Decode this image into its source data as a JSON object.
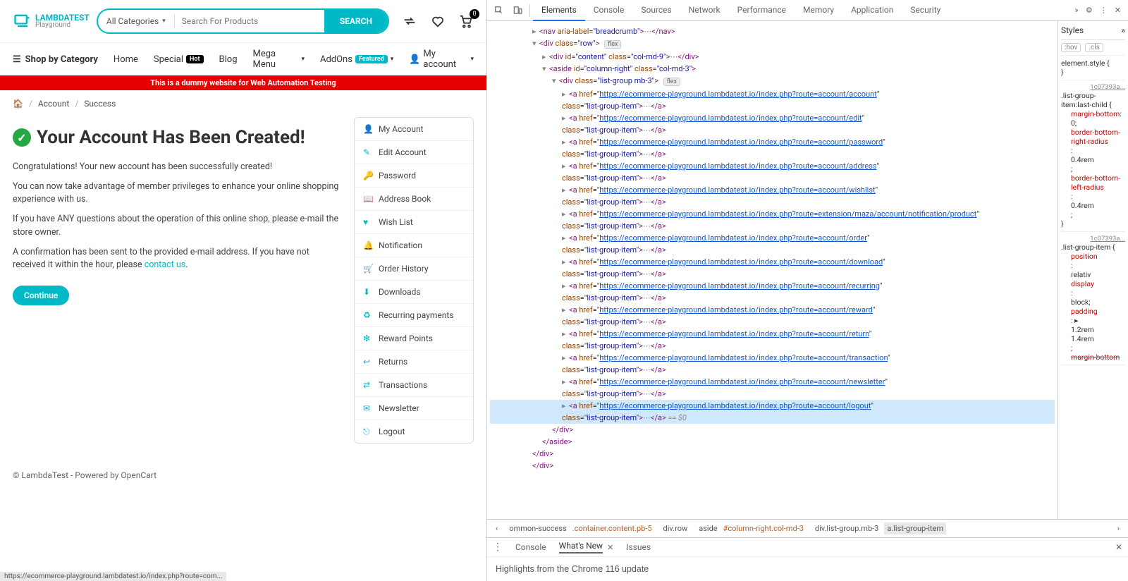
{
  "logo": {
    "line1": "LAMBDATEST",
    "line2": "Playground"
  },
  "search": {
    "category": "All Categories",
    "placeholder": "Search For Products",
    "button": "SEARCH"
  },
  "cart_badge": "0",
  "nav": {
    "shop_cat": "Shop by Category",
    "items": [
      {
        "label": "Home"
      },
      {
        "label": "Special",
        "pill": "Hot"
      },
      {
        "label": "Blog"
      },
      {
        "label": "Mega Menu",
        "caret": true
      },
      {
        "label": "AddOns",
        "pill": "Featured",
        "pillClass": "teal",
        "caret": true
      },
      {
        "label": "My account",
        "caret": true,
        "user": true
      }
    ]
  },
  "redbar": "This is a dummy website for Web Automation Testing",
  "crumbs": [
    "Account",
    "Success"
  ],
  "h1": "Your Account Has Been Created!",
  "paras": [
    "Congratulations! Your new account has been successfully created!",
    "You can now take advantage of member privileges to enhance your online shopping experience with us.",
    "If you have ANY questions about the operation of this online shop, please e-mail the store owner.",
    "A confirmation has been sent to the provided e-mail address. If you have not received it within the hour, please "
  ],
  "contact": "contact us",
  "continue": "Continue",
  "sidebar": [
    {
      "icon": "user",
      "label": "My Account"
    },
    {
      "icon": "edit",
      "label": "Edit Account"
    },
    {
      "icon": "key",
      "label": "Password"
    },
    {
      "icon": "book",
      "label": "Address Book"
    },
    {
      "icon": "heart",
      "label": "Wish List"
    },
    {
      "icon": "bell",
      "label": "Notification"
    },
    {
      "icon": "cart",
      "label": "Order History"
    },
    {
      "icon": "download",
      "label": "Downloads"
    },
    {
      "icon": "refresh",
      "label": "Recurring payments"
    },
    {
      "icon": "gift",
      "label": "Reward Points"
    },
    {
      "icon": "return",
      "label": "Returns"
    },
    {
      "icon": "transaction",
      "label": "Transactions"
    },
    {
      "icon": "mail",
      "label": "Newsletter"
    },
    {
      "icon": "logout",
      "label": "Logout"
    }
  ],
  "footer": "© LambdaTest - Powered by OpenCart",
  "statusbar": "https://ecommerce-playground.lambdatest.io/index.php?route=com...",
  "devtools": {
    "tabs": [
      "Elements",
      "Console",
      "Sources",
      "Network",
      "Performance",
      "Memory",
      "Application",
      "Security"
    ],
    "active_tab": "Elements",
    "styles_label": "Styles",
    "hov": ":hov",
    "cls": ".cls",
    "src_file": "1c07393a...",
    "rule1_sel": ".list-group-item:last-child {",
    "rule1_body": [
      "margin-bottom",
      ": 0;",
      "border-bottom-right-radius",
      ":",
      "0.4rem",
      ";",
      "border-bottom-left-radius",
      ":",
      "0.4rem",
      ";"
    ],
    "rule2_sel": ".list-group-item {",
    "rule2_body": [
      "position",
      ":",
      "relativ",
      "display",
      ":",
      "block;",
      "padding",
      ": ▸",
      "1.2rem",
      "1.4rem",
      ";",
      "margin-bottom"
    ],
    "element_style": "element.style {",
    "crumb": [
      "ommon-success",
      ".container.content.pb-5",
      "div.row",
      "aside#column-right.col-md-3",
      "div.list-group.mb-3",
      "a.list-group-item"
    ],
    "drawer_tabs": [
      "Console",
      "What's New",
      "Issues"
    ],
    "drawer_active": "What's New",
    "drawer_text": "Highlights from the Chrome 116 update",
    "routes": [
      "account/account",
      "account/edit",
      "account/password",
      "account/address",
      "account/wishlist",
      "extension/maza/account/notification/product",
      "account/order",
      "account/download",
      "account/recurring",
      "account/reward",
      "account/return",
      "account/transaction",
      "account/newsletter",
      "account/logout"
    ],
    "base_url": "https://ecommerce-playground.lambdatest.io/index.php?route="
  }
}
